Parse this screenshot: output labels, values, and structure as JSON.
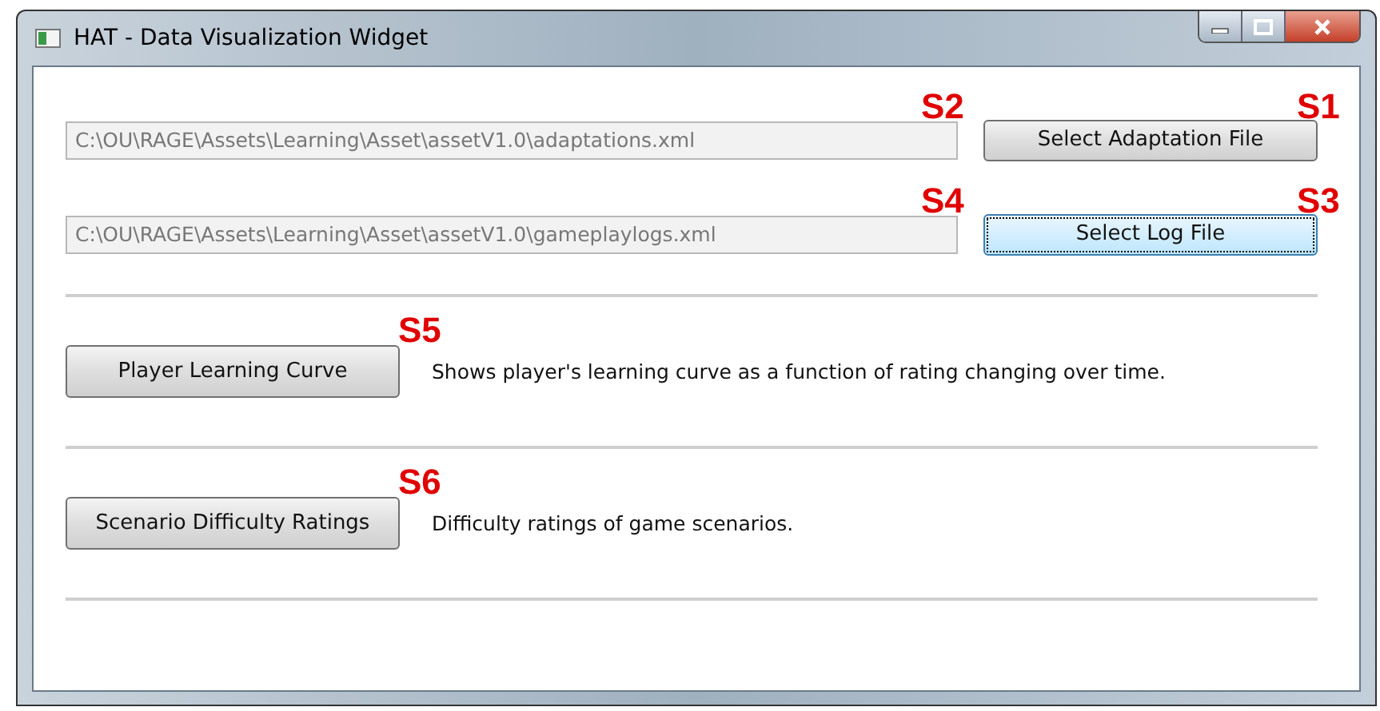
{
  "window": {
    "title": "HAT - Data Visualization Widget"
  },
  "file_rows": [
    {
      "path": "C:\\OU\\RAGE\\Assets\\Learning\\Asset\\assetV1.0\\adaptations.xml",
      "button": "Select Adaptation File",
      "focused": false,
      "field_annotation": "S2",
      "button_annotation": "S1"
    },
    {
      "path": "C:\\OU\\RAGE\\Assets\\Learning\\Asset\\assetV1.0\\gameplaylogs.xml",
      "button": "Select Log File",
      "focused": true,
      "field_annotation": "S4",
      "button_annotation": "S3"
    }
  ],
  "actions": [
    {
      "button": "Player Learning Curve",
      "description": "Shows player's learning curve as a function of rating changing over time.",
      "annotation": "S5"
    },
    {
      "button": "Scenario Difficulty Ratings",
      "description": "Difficulty ratings of game scenarios.",
      "annotation": "S6"
    }
  ]
}
